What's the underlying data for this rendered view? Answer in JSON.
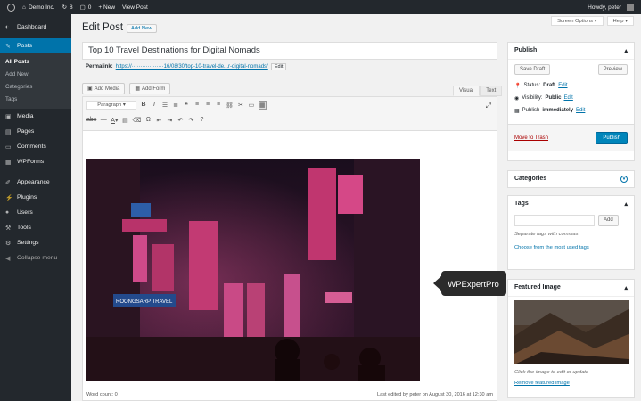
{
  "adminbar": {
    "site": "Demo Inc.",
    "updates": "8",
    "comments": "0",
    "new": "+ New",
    "view": "View Post",
    "howdy": "Howdy, peter"
  },
  "sidebar": {
    "items": [
      {
        "label": "Dashboard",
        "icon": "dashboard-icon"
      },
      {
        "label": "Posts",
        "icon": "pin-icon"
      },
      {
        "label": "Media",
        "icon": "media-icon"
      },
      {
        "label": "Pages",
        "icon": "pages-icon"
      },
      {
        "label": "Comments",
        "icon": "comments-icon"
      },
      {
        "label": "WPForms",
        "icon": "forms-icon"
      },
      {
        "label": "Appearance",
        "icon": "brush-icon"
      },
      {
        "label": "Plugins",
        "icon": "plugin-icon"
      },
      {
        "label": "Users",
        "icon": "users-icon"
      },
      {
        "label": "Tools",
        "icon": "wrench-icon"
      },
      {
        "label": "Settings",
        "icon": "settings-icon"
      },
      {
        "label": "Collapse menu",
        "icon": "collapse-icon"
      }
    ],
    "posts_sub": [
      "All Posts",
      "Add New",
      "Categories",
      "Tags"
    ]
  },
  "header": {
    "title": "Edit Post",
    "add_new": "Add New",
    "screen_options": "Screen Options ▾",
    "help": "Help ▾"
  },
  "post": {
    "title": "Top 10 Travel Destinations for Digital Nomads",
    "permalink_label": "Permalink:",
    "permalink_url": "https://··················16/08/30/top-10-travel-de...r-digital-nomads/",
    "permalink_edit": "Edit"
  },
  "editor": {
    "add_media": "Add Media",
    "add_form": "Add Form",
    "tab_visual": "Visual",
    "tab_text": "Text",
    "format": "Paragraph",
    "word_count": "Word count: 0",
    "last_edited": "Last edited by peter on August 30, 2016 at 12:30 am",
    "image_signs": [
      "ROONGSARP TRAVEL"
    ],
    "callout": "WPExpertPro"
  },
  "publish": {
    "title": "Publish",
    "save_draft": "Save Draft",
    "preview": "Preview",
    "status_label": "Status:",
    "status": "Draft",
    "status_edit": "Edit",
    "visibility_label": "Visibility:",
    "visibility": "Public",
    "visibility_edit": "Edit",
    "publish_label": "Publish",
    "publish_when": "immediately",
    "publish_edit": "Edit",
    "trash": "Move to Trash",
    "publish_btn": "Publish"
  },
  "categories": {
    "title": "Categories"
  },
  "tags": {
    "title": "Tags",
    "add": "Add",
    "hint": "Separate tags with commas",
    "choose": "Choose from the most used tags"
  },
  "featured": {
    "title": "Featured Image",
    "hint": "Click the image to edit or update",
    "remove": "Remove featured image"
  }
}
